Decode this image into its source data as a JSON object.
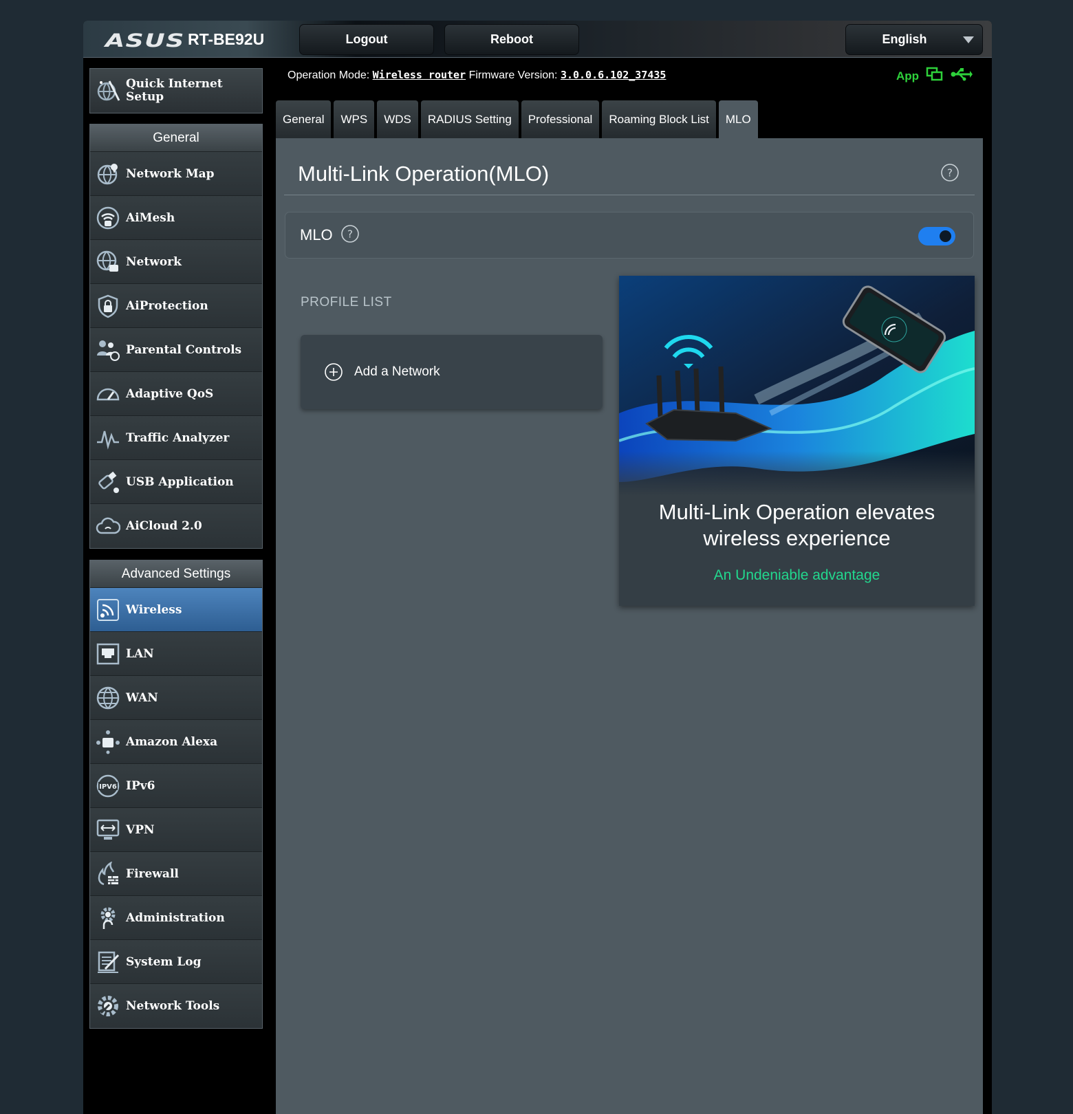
{
  "header": {
    "brand": "ASUS",
    "model": "RT-BE92U",
    "logout_label": "Logout",
    "reboot_label": "Reboot",
    "language": "English"
  },
  "status": {
    "operation_mode_label": "Operation Mode:",
    "operation_mode_value": "Wireless router",
    "firmware_label": "Firmware Version:",
    "firmware_value": "3.0.0.6.102_37435",
    "app_label": "App"
  },
  "sidebar": {
    "quick_setup": "Quick Internet Setup",
    "general_title": "General",
    "general_items": [
      {
        "label": "Network Map",
        "icon": "globe-pin-icon"
      },
      {
        "label": "AiMesh",
        "icon": "aimesh-icon"
      },
      {
        "label": "Network",
        "icon": "network-globe-icon"
      },
      {
        "label": "AiProtection",
        "icon": "shield-lock-icon"
      },
      {
        "label": "Parental Controls",
        "icon": "family-icon"
      },
      {
        "label": "Adaptive QoS",
        "icon": "speedometer-icon"
      },
      {
        "label": "Traffic Analyzer",
        "icon": "pulse-icon"
      },
      {
        "label": "USB Application",
        "icon": "usb-icon"
      },
      {
        "label": "AiCloud 2.0",
        "icon": "cloud-icon"
      }
    ],
    "advanced_title": "Advanced Settings",
    "advanced_items": [
      {
        "label": "Wireless",
        "icon": "wifi-icon",
        "active": true
      },
      {
        "label": "LAN",
        "icon": "lan-port-icon"
      },
      {
        "label": "WAN",
        "icon": "wan-globe-icon"
      },
      {
        "label": "Amazon Alexa",
        "icon": "alexa-icon"
      },
      {
        "label": "IPv6",
        "icon": "ipv6-icon"
      },
      {
        "label": "VPN",
        "icon": "vpn-monitor-icon"
      },
      {
        "label": "Firewall",
        "icon": "firewall-icon"
      },
      {
        "label": "Administration",
        "icon": "admin-gear-icon"
      },
      {
        "label": "System Log",
        "icon": "log-icon"
      },
      {
        "label": "Network Tools",
        "icon": "tools-gear-icon"
      }
    ]
  },
  "tabs": [
    "General",
    "WPS",
    "WDS",
    "RADIUS Setting",
    "Professional",
    "Roaming Block List",
    "MLO"
  ],
  "active_tab": "MLO",
  "main": {
    "title": "Multi-Link Operation(MLO)",
    "mlo_label": "MLO",
    "mlo_enabled": true,
    "profile_list_label": "PROFILE LIST",
    "add_network_label": "Add a Network",
    "promo_headline": "Multi-Link Operation elevates wireless experience",
    "promo_sub": "An Undeniable advantage"
  },
  "colors": {
    "accent_blue": "#1f7ff0",
    "promo_green": "#22d88e",
    "app_green": "#2ed13b",
    "active_menu": "#3d72aa"
  }
}
